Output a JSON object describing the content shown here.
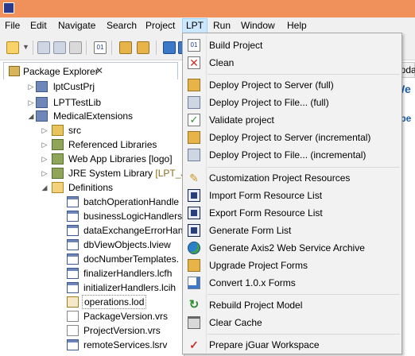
{
  "menubar": {
    "items": [
      "File",
      "Edit",
      "Navigate",
      "Search",
      "Project",
      "LPT",
      "Run",
      "Window",
      "Help"
    ]
  },
  "explorer": {
    "tab_label": "Package Explorer",
    "close_glyph": "✕",
    "rows": [
      {
        "label": "lptCustPrj",
        "icon": "project-icon"
      },
      {
        "label": "LPTTestLib",
        "icon": "project-icon"
      },
      {
        "label": "MedicalExtensions",
        "icon": "project-icon"
      },
      {
        "label": "src",
        "icon": "package-folder-icon"
      },
      {
        "label": "Referenced Libraries",
        "icon": "library-icon"
      },
      {
        "label": "Web App Libraries [logo]",
        "icon": "library-icon"
      },
      {
        "label": "JRE System Library",
        "deco": "[LPT_JR",
        "icon": "library-icon"
      },
      {
        "label": "Definitions",
        "icon": "folder-open-icon"
      },
      {
        "label": "batchOperationHandle",
        "icon": "file-icon"
      },
      {
        "label": "businessLogicHandlers",
        "icon": "file-icon"
      },
      {
        "label": "dataExchangeErrorHand",
        "icon": "file-icon"
      },
      {
        "label": "dbViewObjects.lview",
        "icon": "file-icon"
      },
      {
        "label": "docNumberTemplates.",
        "icon": "file-icon"
      },
      {
        "label": "finalizerHandlers.lcfh",
        "icon": "file-icon"
      },
      {
        "label": "initializerHandlers.lcih",
        "icon": "file-icon"
      },
      {
        "label": "operations.lod",
        "icon": "lod-file-icon"
      },
      {
        "label": "PackageVersion.vrs",
        "icon": "file-icon"
      },
      {
        "label": "ProjectVersion.vrs",
        "icon": "file-icon"
      },
      {
        "label": "remoteServices.lsrv",
        "icon": "file-icon"
      }
    ]
  },
  "right_pane": {
    "tab_label": "Upda",
    "heading": "We",
    "link": "Ope"
  },
  "lpt_menu": {
    "items": [
      {
        "label": "Build Project",
        "icon": "binary-icon"
      },
      {
        "label": "Clean",
        "icon": "clean-icon"
      },
      {
        "label": "Deploy Project to Server (full)",
        "icon": "deploy-server-icon"
      },
      {
        "label": "Deploy Project to File... (full)",
        "icon": "deploy-file-icon"
      },
      {
        "label": "Validate project",
        "icon": "validate-icon"
      },
      {
        "label": "Deploy Project to Server (incremental)",
        "icon": "deploy-server-icon"
      },
      {
        "label": "Deploy Project to File... (incremental)",
        "icon": "deploy-file-icon"
      },
      {
        "label": "Customization Project Resources",
        "icon": "pencil-icon"
      },
      {
        "label": "Import Form Resource List",
        "icon": "form-list-icon"
      },
      {
        "label": "Export Form Resource List",
        "icon": "form-list-icon"
      },
      {
        "label": "Generate Form List",
        "icon": "form-list-icon"
      },
      {
        "label": "Generate Axis2 Web Service Archive",
        "icon": "globe-icon"
      },
      {
        "label": "Upgrade Project Forms",
        "icon": "upgrade-icon"
      },
      {
        "label": "Convert 1.0.x Forms",
        "icon": "convert-icon"
      },
      {
        "label": "Rebuild Project Model",
        "icon": "rebuild-icon"
      },
      {
        "label": "Clear Cache",
        "icon": "trash-icon"
      },
      {
        "label": "Prepare jGuar Workspace",
        "icon": "check-icon"
      }
    ]
  },
  "colors": {
    "titlebar": "#f0915b",
    "menu_highlight": "#cce8ff",
    "link_blue": "#1d5ea8"
  }
}
